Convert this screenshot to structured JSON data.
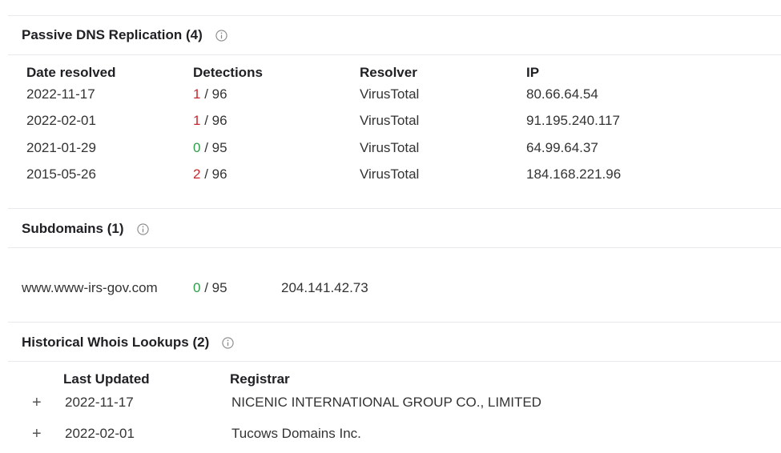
{
  "passive_dns": {
    "title": "Passive DNS Replication (4)",
    "columns": {
      "date": "Date resolved",
      "detections": "Detections",
      "resolver": "Resolver",
      "ip": "IP"
    },
    "rows": [
      {
        "date": "2022-11-17",
        "det": "1",
        "total": "/ 96",
        "resolver": "VirusTotal",
        "ip": "80.66.64.54",
        "status": "bad"
      },
      {
        "date": "2022-02-01",
        "det": "1",
        "total": "/ 96",
        "resolver": "VirusTotal",
        "ip": "91.195.240.117",
        "status": "bad"
      },
      {
        "date": "2021-01-29",
        "det": "0",
        "total": "/ 95",
        "resolver": "VirusTotal",
        "ip": "64.99.64.37",
        "status": "good"
      },
      {
        "date": "2015-05-26",
        "det": "2",
        "total": "/ 96",
        "resolver": "VirusTotal",
        "ip": "184.168.221.96",
        "status": "bad"
      }
    ]
  },
  "subdomains": {
    "title": "Subdomains (1)",
    "rows": [
      {
        "domain": "www.www-irs-gov.com",
        "det": "0",
        "total": "/ 95",
        "ip": "204.141.42.73",
        "status": "good"
      }
    ]
  },
  "whois": {
    "title": "Historical Whois Lookups (2)",
    "columns": {
      "updated": "Last Updated",
      "registrar": "Registrar"
    },
    "rows": [
      {
        "expand": "+",
        "date": "2022-11-17",
        "registrar": "NICENIC INTERNATIONAL GROUP CO., LIMITED"
      },
      {
        "expand": "+",
        "date": "2022-02-01",
        "registrar": "Tucows Domains Inc."
      }
    ]
  },
  "colors": {
    "detection_positive": "#c6262e",
    "detection_clean": "#2e9e48"
  },
  "icons": {
    "info": "info-circle-icon",
    "expand": "plus-icon"
  }
}
